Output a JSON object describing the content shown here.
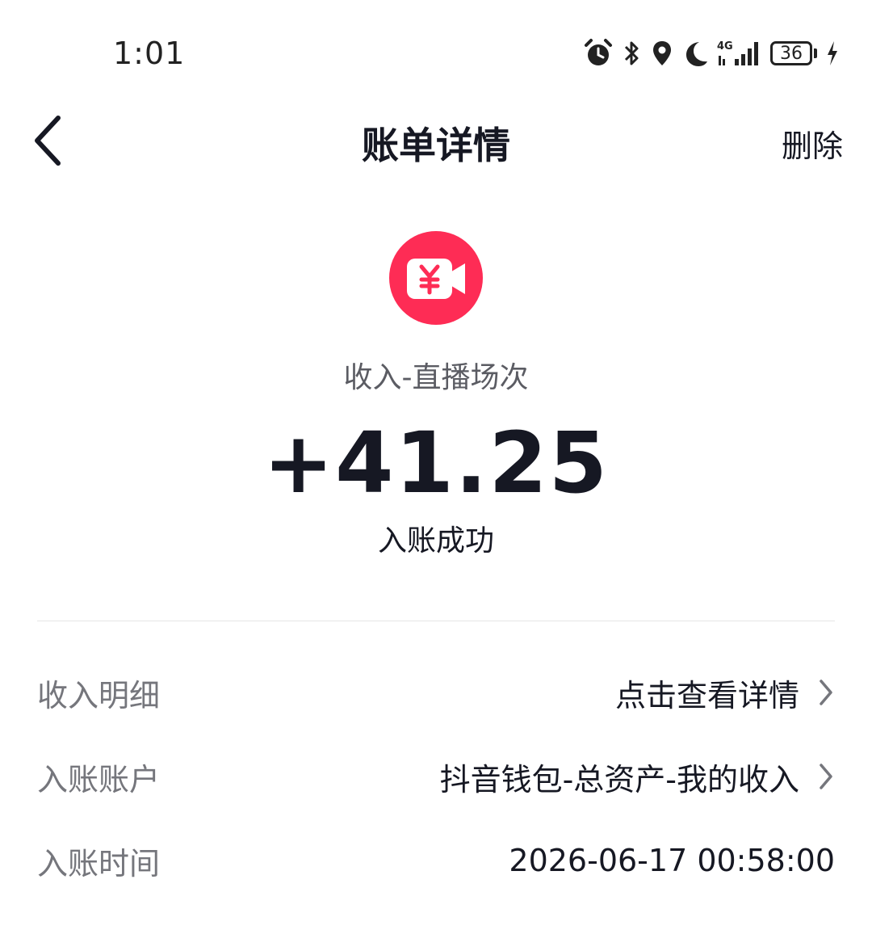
{
  "status_bar": {
    "time": "1:01",
    "network": "4G",
    "battery": "36",
    "icons": [
      "alarm-icon",
      "bluetooth-icon",
      "location-icon",
      "moon-icon",
      "signal-icon",
      "battery-icon",
      "charging-icon"
    ]
  },
  "nav": {
    "title": "账单详情",
    "delete_label": "删除"
  },
  "header": {
    "icon": "live-video-yuan-icon",
    "icon_color": "#fe2c55",
    "category": "收入-直播场次",
    "amount": "+41.25",
    "status": "入账成功"
  },
  "details": [
    {
      "label": "收入明细",
      "value": "点击查看详情",
      "has_chevron": true
    },
    {
      "label": "入账账户",
      "value": "抖音钱包-总资产-我的收入",
      "has_chevron": true
    },
    {
      "label": "入账时间",
      "value": "2026-06-17 00:58:00",
      "has_chevron": false
    }
  ]
}
